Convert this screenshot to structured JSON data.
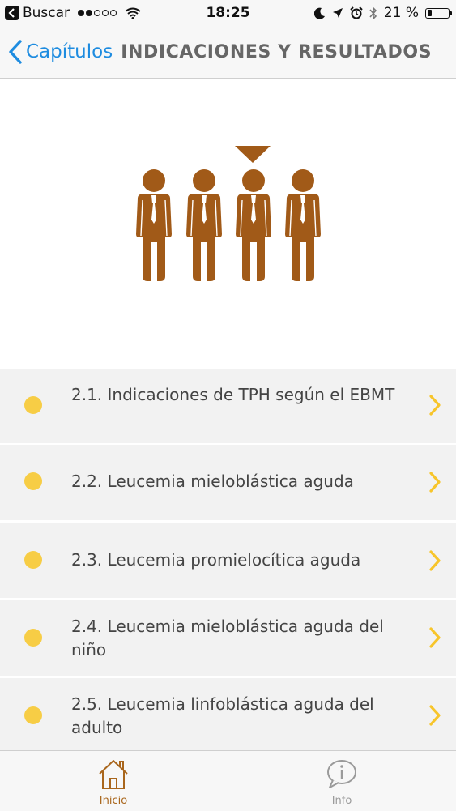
{
  "status_bar": {
    "back_app_label": "Buscar",
    "time": "18:25",
    "battery_text": "21 %",
    "battery_level": 0.21,
    "signal_bars_filled": 2,
    "signal_bars_total": 5
  },
  "nav": {
    "back_label": "Capítulos",
    "title": "INDICACIONES Y RESULTADOS",
    "accent_color": "#1e8ce0"
  },
  "hero": {
    "icon": "four-people-one-selected-icon",
    "color": "#a15a18"
  },
  "chapters": [
    {
      "label": "2.1. Indicaciones de TPH según el EBMT"
    },
    {
      "label": "2.2. Leucemia mieloblástica aguda"
    },
    {
      "label": "2.3. Leucemia promielocítica aguda"
    },
    {
      "label": "2.4. Leucemia mieloblástica aguda del niño"
    },
    {
      "label": "2.5. Leucemia linfoblástica aguda del adulto"
    }
  ],
  "bullet_color": "#f7cd45",
  "tabs": [
    {
      "label": "Inicio",
      "icon": "home-icon",
      "active": true
    },
    {
      "label": "Info",
      "icon": "info-bubble-icon",
      "active": false
    }
  ]
}
